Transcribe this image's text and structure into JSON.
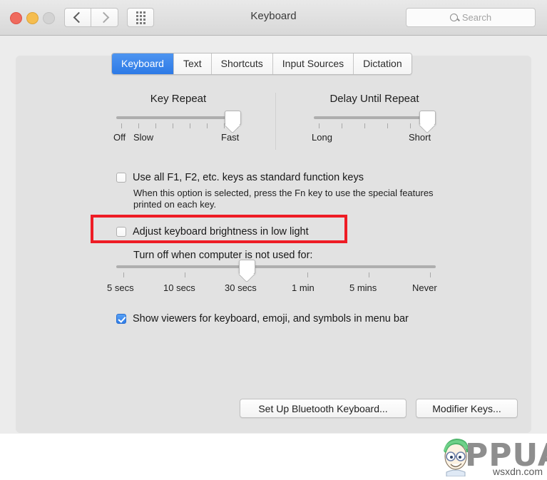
{
  "window": {
    "title": "Keyboard",
    "traffic_lights": [
      "close",
      "minimize",
      "zoom"
    ],
    "nav_back_icon": "chevron-left-icon",
    "nav_forward_icon": "chevron-right-icon",
    "grid_icon": "show-all-grid-icon"
  },
  "search": {
    "placeholder": "Search",
    "icon": "search-icon",
    "value": ""
  },
  "tabs": [
    {
      "label": "Keyboard",
      "active": true
    },
    {
      "label": "Text",
      "active": false
    },
    {
      "label": "Shortcuts",
      "active": false
    },
    {
      "label": "Input Sources",
      "active": false
    },
    {
      "label": "Dictation",
      "active": false
    }
  ],
  "key_repeat": {
    "title": "Key Repeat",
    "left_label": "Off",
    "second_label": "Slow",
    "right_label": "Fast",
    "tick_count": 8,
    "value_position_percent": 100
  },
  "delay_until_repeat": {
    "title": "Delay Until Repeat",
    "left_label": "Long",
    "right_label": "Short",
    "tick_count": 6,
    "value_position_percent": 100
  },
  "function_keys": {
    "label": "Use all F1, F2, etc. keys as standard function keys",
    "checked": false,
    "help_line1": "When this option is selected, press the Fn key to use the special features",
    "help_line2": "printed on each key."
  },
  "keyboard_brightness": {
    "label": "Adjust keyboard brightness in low light",
    "checked": false,
    "highlight_color": "#ee1c25"
  },
  "turn_off_timer": {
    "label": "Turn off when computer is not used for:",
    "ticks": [
      "5 secs",
      "10 secs",
      "30 secs",
      "1 min",
      "5 mins",
      "Never"
    ],
    "selected": "30 secs",
    "selected_index": 2
  },
  "show_viewers": {
    "label": "Show viewers for keyboard, emoji, and symbols in menu bar",
    "checked": true
  },
  "buttons": {
    "bluetooth": "Set Up Bluetooth Keyboard...",
    "modifier": "Modifier Keys..."
  },
  "watermark": {
    "brand": "PPUALS",
    "site": "wsxdn.com"
  }
}
